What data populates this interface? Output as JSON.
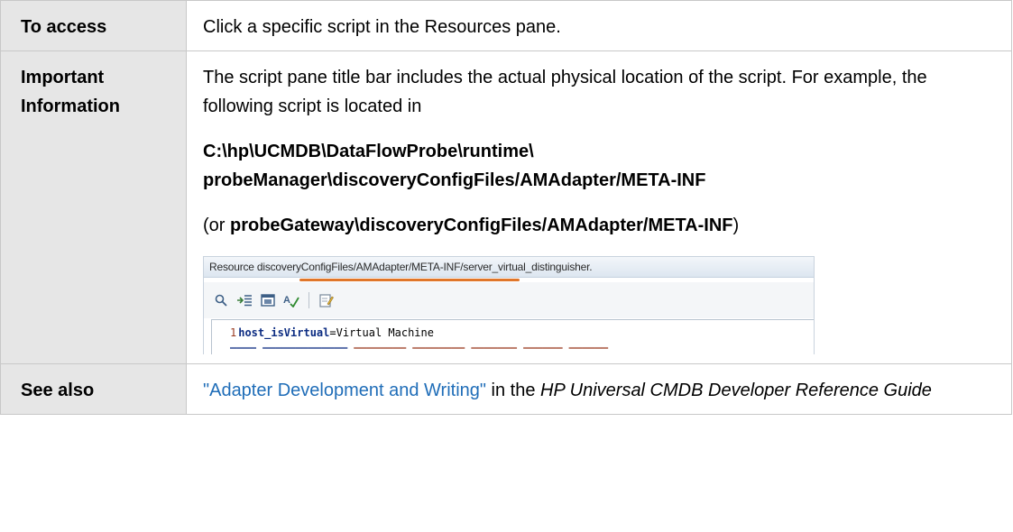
{
  "rows": {
    "access": {
      "label": "To access",
      "text": "Click a specific script in the Resources pane."
    },
    "important": {
      "label_line1": "Important",
      "label_line2": "Information",
      "p1": "The script pane title bar includes the actual physical location of the script. For example, the following script is located in",
      "path_line1": "C:\\hp\\UCMDB\\DataFlowProbe\\runtime\\",
      "path_line2": "probeManager\\discoveryConfigFiles/AMAdapter/META-INF",
      "alt_prefix": "(or ",
      "alt_path": "probeGateway\\discoveryConfigFiles/AMAdapter/META-INF",
      "alt_suffix": ")"
    },
    "see_also": {
      "label": "See also",
      "link_text": "\"Adapter Development and Writing\"",
      "middle": " in the ",
      "guide": "HP Universal CMDB Developer Reference Guide"
    }
  },
  "screenshot": {
    "title": "Resource discoveryConfigFiles/AMAdapter/META-INF/server_virtual_distinguisher.",
    "accent_color": "#e0762a",
    "toolbar_icons": [
      "search-icon",
      "indent-icon",
      "window-icon",
      "spell-check-icon",
      "edit-icon"
    ],
    "code_lines": [
      {
        "num": "1",
        "key": "host_isVirtual",
        "value": "=Virtual Machine"
      }
    ]
  }
}
